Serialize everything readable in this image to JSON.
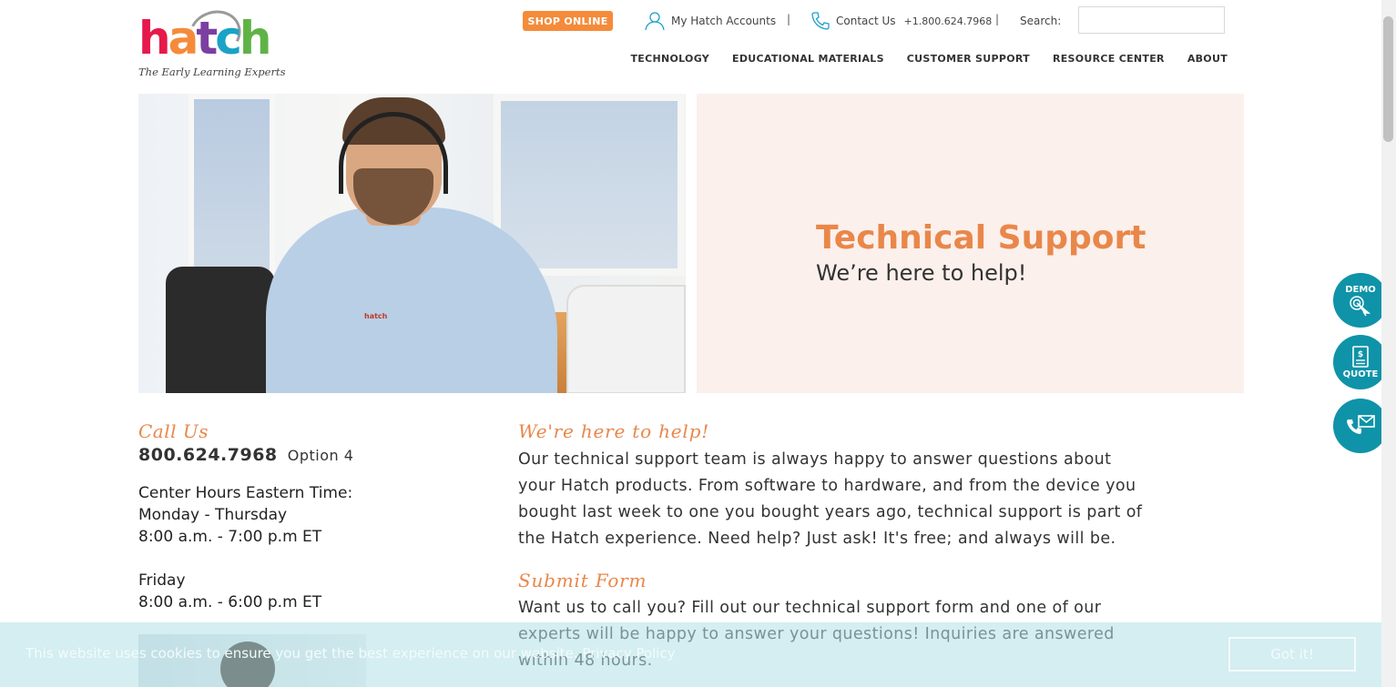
{
  "brand": {
    "logo_letters": [
      "h",
      "a",
      "t",
      "c",
      "h"
    ],
    "logo_colors": [
      "#e6194b",
      "#f58b3a",
      "#7b3fa0",
      "#1aa3c7",
      "#5fb346"
    ],
    "tagline": "The Early Learning Experts"
  },
  "header": {
    "shop_label": "SHOP ONLINE",
    "accounts_label": "My Hatch Accounts",
    "contact_label": "Contact Us",
    "contact_phone": "+1.800.624.7968",
    "separator": "|",
    "search_label": "Search:",
    "search_value": ""
  },
  "nav": {
    "items": [
      "TECHNOLOGY",
      "EDUCATIONAL MATERIALS",
      "CUSTOMER SUPPORT",
      "RESOURCE CENTER",
      "ABOUT"
    ]
  },
  "hero": {
    "title": "Technical Support",
    "subtitle": "We’re here to help!",
    "shirt_logo": "hatch"
  },
  "left": {
    "call_title": "Call Us",
    "phone": "800.624.7968",
    "phone_option": "Option 4",
    "hours_heading": "Center Hours Eastern Time:",
    "weekday_days": "Monday - Thursday",
    "weekday_hours": "8:00 a.m. - 7:00 p.m ET",
    "friday_day": "Friday",
    "friday_hours": "8:00 a.m. - 6:00 p.m ET"
  },
  "right": {
    "help_title": "We're here to help!",
    "help_body": "Our technical support team is always happy to answer questions about your Hatch products. From software to hardware, and from the device you bought last week to one you bought years ago, technical support is part of the Hatch experience. Need help? Just ask! It's free; and always will be.",
    "submit_title": "Submit Form",
    "submit_body": "Want us to call you? Fill out our technical support form and one of our experts will be happy to answer your questions! Inquiries are answered within 48 hours."
  },
  "cookie": {
    "text": "This website uses cookies to ensure you get the best experience on our website. Privacy Policy",
    "button": "Got it!"
  },
  "floating": {
    "demo": "DEMO",
    "quote": "QUOTE",
    "quote_symbol": "$"
  },
  "colors": {
    "accent_orange": "#e9874a",
    "shop_button": "#f58b3a",
    "teal": "#0f93a8",
    "hero_panel": "#fbf0ec"
  }
}
